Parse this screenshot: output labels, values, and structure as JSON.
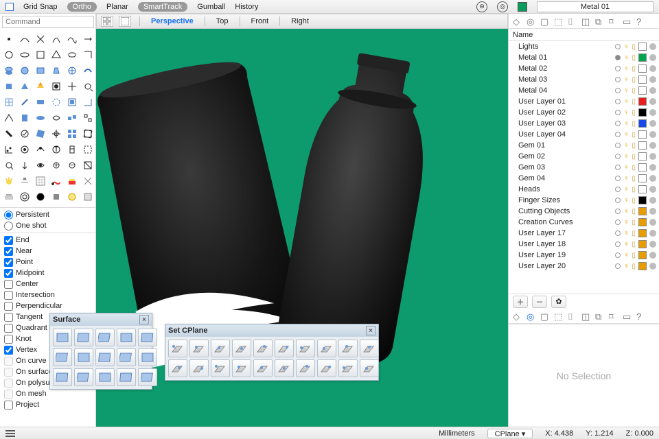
{
  "topbar": {
    "grid_snap": "Grid Snap",
    "ortho": "Ortho",
    "planar": "Planar",
    "smarttrack": "SmartTrack",
    "gumball": "Gumball",
    "history": "History",
    "layer_field": "Metal 01"
  },
  "viewbar": {
    "tabs": [
      "Perspective",
      "Top",
      "Front",
      "Right"
    ],
    "active": 0
  },
  "command_placeholder": "Command",
  "osnap": {
    "persistent": "Persistent",
    "oneshot": "One shot",
    "options": [
      {
        "label": "End",
        "checked": true
      },
      {
        "label": "Near",
        "checked": true
      },
      {
        "label": "Point",
        "checked": true
      },
      {
        "label": "Midpoint",
        "checked": true
      },
      {
        "label": "Center",
        "checked": false
      },
      {
        "label": "Intersection",
        "checked": false
      },
      {
        "label": "Perpendicular",
        "checked": false
      },
      {
        "label": "Tangent",
        "checked": false
      },
      {
        "label": "Quadrant",
        "checked": false
      },
      {
        "label": "Knot",
        "checked": false
      },
      {
        "label": "Vertex",
        "checked": true
      },
      {
        "label": "On curve",
        "checked": false,
        "disabled": true
      },
      {
        "label": "On surface",
        "checked": false,
        "disabled": true
      },
      {
        "label": "On polysurface",
        "checked": false,
        "disabled": true
      },
      {
        "label": "On mesh",
        "checked": false,
        "disabled": true
      },
      {
        "label": "Project",
        "checked": false
      }
    ]
  },
  "palettes": {
    "surface": {
      "title": "Surface"
    },
    "cplane": {
      "title": "Set CPlane"
    }
  },
  "layers_header": "Name",
  "layers": [
    {
      "name": "Lights",
      "color": "#ffffff"
    },
    {
      "name": "Metal 01",
      "color": "#00a54f",
      "current": true
    },
    {
      "name": "Metal 02",
      "color": "#ffffff"
    },
    {
      "name": "Metal 03",
      "color": "#ffffff"
    },
    {
      "name": "Metal 04",
      "color": "#ffffff"
    },
    {
      "name": "User Layer 01",
      "color": "#e81e1e"
    },
    {
      "name": "User Layer 02",
      "color": "#000000"
    },
    {
      "name": "User Layer 03",
      "color": "#1649e8"
    },
    {
      "name": "User Layer 04",
      "color": "#ffffff"
    },
    {
      "name": "Gem 01",
      "color": "#ffffff"
    },
    {
      "name": "Gem 02",
      "color": "#ffffff"
    },
    {
      "name": "Gem 03",
      "color": "#ffffff"
    },
    {
      "name": "Gem 04",
      "color": "#ffffff"
    },
    {
      "name": "Heads",
      "color": "#ffffff"
    },
    {
      "name": "Finger Sizes",
      "color": "#000000"
    },
    {
      "name": "Cutting Objects",
      "color": "#e79c00"
    },
    {
      "name": "Creation Curves",
      "color": "#e79c00"
    },
    {
      "name": "User Layer 17",
      "color": "#e79c00"
    },
    {
      "name": "User Layer 18",
      "color": "#e79c00"
    },
    {
      "name": "User Layer 19",
      "color": "#e79c00"
    },
    {
      "name": "User Layer 20",
      "color": "#e79c00"
    }
  ],
  "no_selection": "No Selection",
  "status": {
    "units": "Millimeters",
    "cplane_label": "CPlane",
    "x": "X: 4.438",
    "y": "Y: 1.214",
    "z": "Z: 0.000"
  }
}
